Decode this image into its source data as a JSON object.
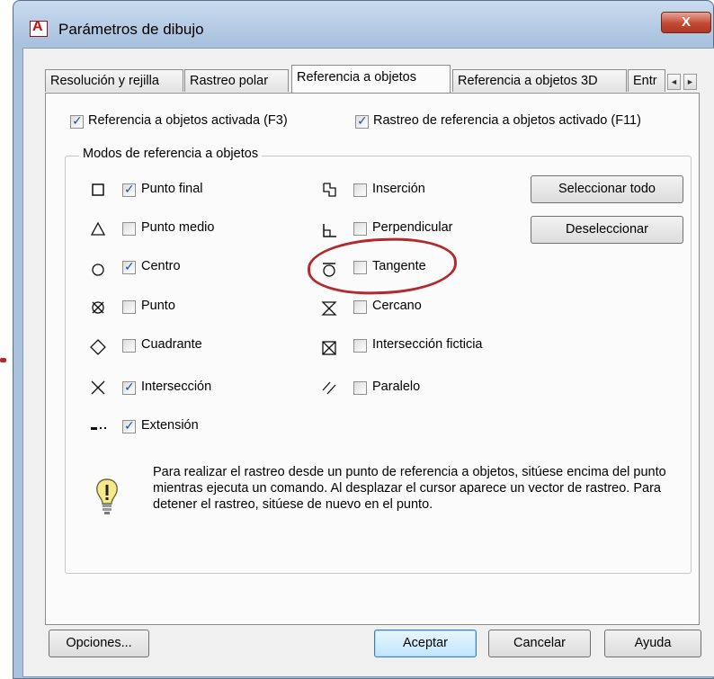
{
  "window": {
    "title": "Parámetros de dibujo",
    "close_label": "X"
  },
  "tabs": [
    {
      "label": "Resolución y rejilla",
      "active": false
    },
    {
      "label": "Rastreo polar",
      "active": false
    },
    {
      "label": "Referencia a objetos",
      "active": true
    },
    {
      "label": "Referencia a objetos 3D",
      "active": false
    },
    {
      "label": "Entr",
      "active": false
    }
  ],
  "tab_scroll": {
    "left": "◄",
    "right": "►"
  },
  "top_options": {
    "osnap_on": {
      "label": "Referencia a objetos activada (F3)",
      "checked": true
    },
    "otrack_on": {
      "label": "Rastreo de referencia a objetos activado (F11)",
      "checked": true
    }
  },
  "group": {
    "title": "Modos de referencia a objetos"
  },
  "modes_left": [
    {
      "label": "Punto final",
      "checked": true,
      "symbol": "square-icon"
    },
    {
      "label": "Punto medio",
      "checked": false,
      "symbol": "triangle-icon"
    },
    {
      "label": "Centro",
      "checked": true,
      "symbol": "circle-icon"
    },
    {
      "label": "Punto",
      "checked": false,
      "symbol": "node-icon"
    },
    {
      "label": "Cuadrante",
      "checked": false,
      "symbol": "diamond-icon"
    },
    {
      "label": "Intersección",
      "checked": true,
      "symbol": "x-icon"
    },
    {
      "label": "Extensión",
      "checked": true,
      "symbol": "extension-icon"
    }
  ],
  "modes_right": [
    {
      "label": "Inserción",
      "checked": false,
      "symbol": "insertion-icon"
    },
    {
      "label": "Perpendicular",
      "checked": false,
      "symbol": "perpendicular-icon"
    },
    {
      "label": "Tangente",
      "checked": false,
      "symbol": "tangent-icon"
    },
    {
      "label": "Cercano",
      "checked": false,
      "symbol": "nearest-icon"
    },
    {
      "label": "Intersección ficticia",
      "checked": false,
      "symbol": "apparent-intersection-icon"
    },
    {
      "label": "Paralelo",
      "checked": false,
      "symbol": "parallel-icon"
    }
  ],
  "buttons": {
    "select_all": "Seleccionar todo",
    "clear_all": "Deseleccionar",
    "options": "Opciones...",
    "ok": "Aceptar",
    "cancel": "Cancelar",
    "help": "Ayuda"
  },
  "info_text": "Para realizar el rastreo desde un punto de referencia a objetos, sitúese encima del punto mientras ejecuta un comando. Al desplazar el cursor aparece un vector de rastreo. Para detener el rastreo, sitúese de nuevo en el punto.",
  "colors": {
    "annotation": "#b02a2e",
    "checkmark": "#1f4fa0"
  }
}
